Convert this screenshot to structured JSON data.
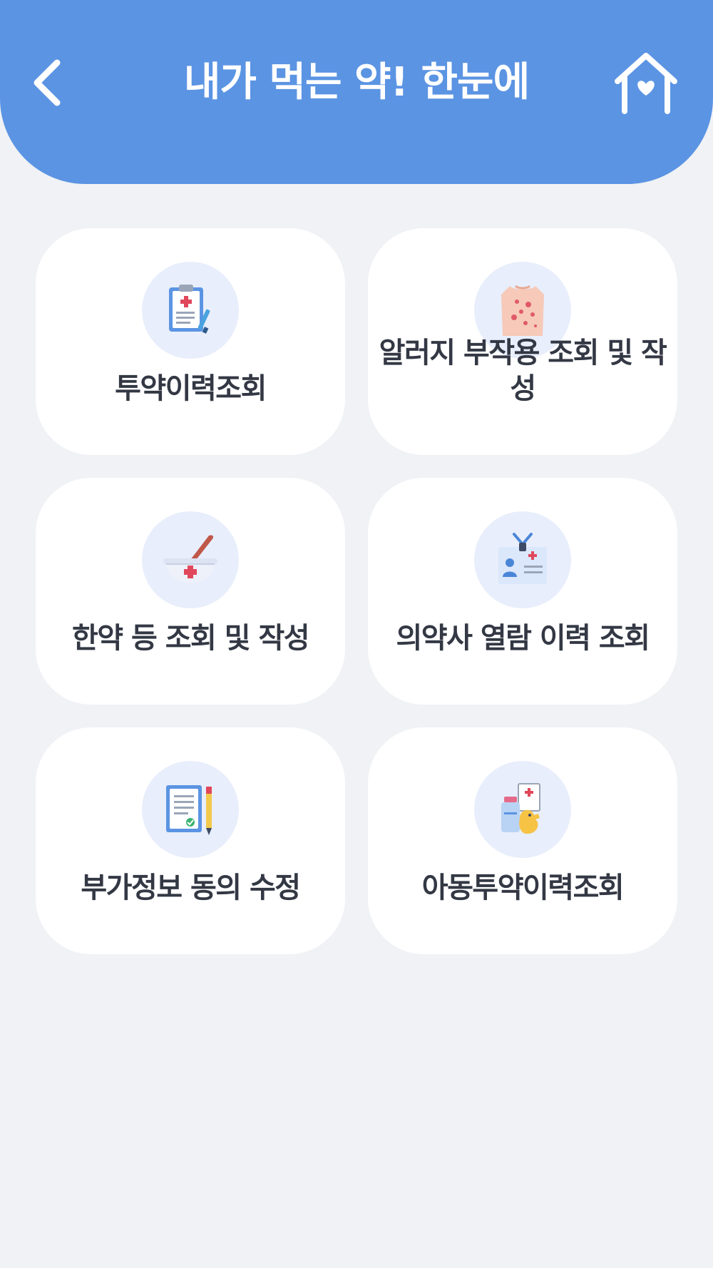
{
  "header": {
    "title": "내가 먹는 약! 한눈에",
    "back_icon": "chevron-left-icon",
    "home_icon": "home-heart-icon",
    "background_color": "#5b94e3"
  },
  "menu": {
    "items": [
      {
        "label": "투약이력조회",
        "icon": "clipboard-medical-icon"
      },
      {
        "label": "알러지 부작용 조회 및 작성",
        "icon": "skin-rash-icon"
      },
      {
        "label": "한약 등 조회 및 작성",
        "icon": "mortar-pestle-icon"
      },
      {
        "label": "의약사 열람 이력 조회",
        "icon": "medical-id-card-icon"
      },
      {
        "label": "부가정보 동의 수정",
        "icon": "document-pencil-icon"
      },
      {
        "label": "아동투약이력조회",
        "icon": "child-medicine-duck-icon"
      }
    ]
  },
  "colors": {
    "page_background": "#f0f2f5",
    "card_background": "#ffffff",
    "icon_circle": "#e8eefb",
    "label_text": "#333844"
  }
}
